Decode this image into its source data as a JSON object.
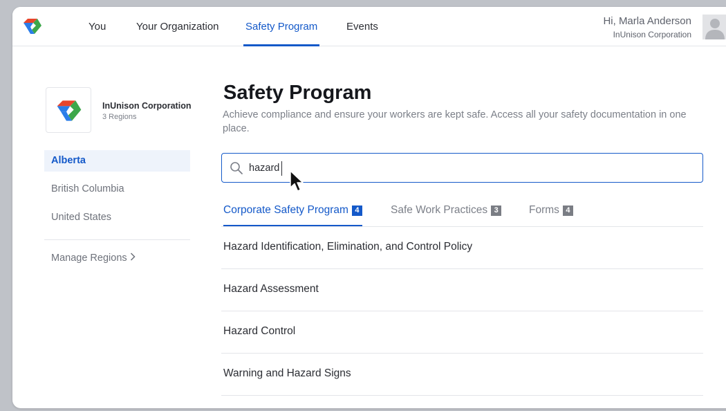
{
  "colors": {
    "accent": "#1459c9",
    "text": "#2b2d33",
    "muted": "#7b7f88",
    "badge_gray": "#7a7d84",
    "logo_red": "#e8452c",
    "logo_blue": "#2b7de9",
    "logo_green": "#3da74a"
  },
  "nav": {
    "logo_icon": "inunison-logo-icon",
    "items": [
      {
        "label": "You"
      },
      {
        "label": "Your Organization"
      },
      {
        "label": "Safety Program"
      },
      {
        "label": "Events"
      }
    ],
    "active": "Safety Program",
    "user": {
      "greeting": "Hi, Marla Anderson",
      "org": "InUnison Corporation",
      "avatar_icon": "user-avatar-icon"
    }
  },
  "sidebar": {
    "org": {
      "name": "InUnison Corporation",
      "regions": "3 Regions"
    },
    "regions": [
      {
        "label": "Alberta"
      },
      {
        "label": "British Columbia"
      },
      {
        "label": "United States"
      }
    ],
    "active_region": "Alberta",
    "manage_label": "Manage Regions",
    "manage_icon": "chevron-right-icon"
  },
  "main": {
    "title": "Safety Program",
    "description": "Achieve compliance and ensure your workers are kept safe. Access all your safety documentation in one place.",
    "search": {
      "value": "hazard",
      "icon": "search-icon"
    },
    "tabs": [
      {
        "label": "Corporate Safety Program",
        "count": "4"
      },
      {
        "label": "Safe Work Practices",
        "count": "3"
      },
      {
        "label": "Forms",
        "count": "4"
      }
    ],
    "active_tab": "Corporate Safety Program",
    "results": [
      {
        "title": "Hazard Identification, Elimination, and Control Policy"
      },
      {
        "title": "Hazard Assessment"
      },
      {
        "title": "Hazard Control"
      },
      {
        "title": "Warning and Hazard Signs"
      }
    ]
  }
}
